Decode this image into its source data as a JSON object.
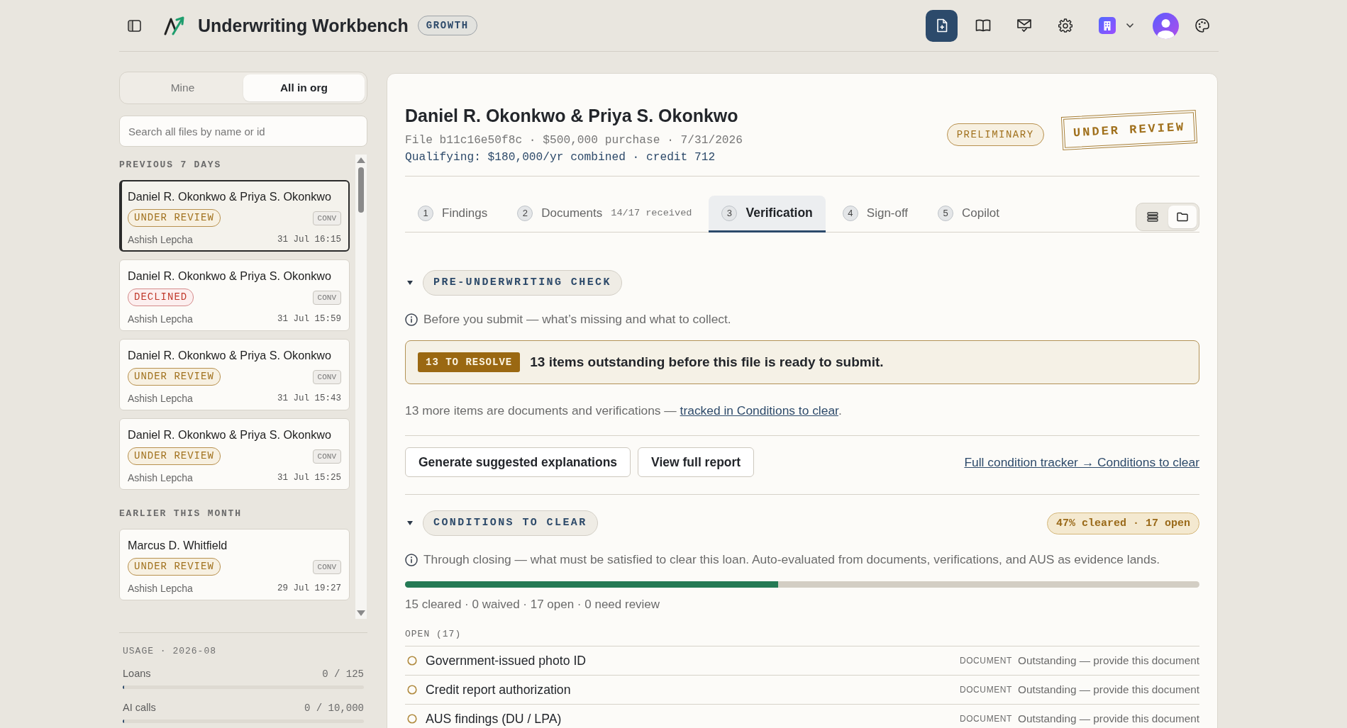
{
  "header": {
    "title": "Underwriting Workbench",
    "plan": "GROWTH"
  },
  "sidebar": {
    "scope_tabs": [
      {
        "label": "Mine",
        "selected": false
      },
      {
        "label": "All in org",
        "selected": true
      }
    ],
    "search": {
      "placeholder": "Search all files by name or id"
    },
    "groups": [
      {
        "heading": "PREVIOUS 7 DAYS",
        "files": [
          {
            "name": "Daniel R. Okonkwo & Priya S. Okonkwo",
            "status": {
              "label": "UNDER REVIEW",
              "kind": "review"
            },
            "program": "CONV",
            "owner": "Ashish Lepcha",
            "time": "31 Jul 16:15",
            "selected": true
          },
          {
            "name": "Daniel R. Okonkwo & Priya S. Okonkwo",
            "status": {
              "label": "DECLINED",
              "kind": "declined"
            },
            "program": "CONV",
            "owner": "Ashish Lepcha",
            "time": "31 Jul 15:59",
            "selected": false
          },
          {
            "name": "Daniel R. Okonkwo & Priya S. Okonkwo",
            "status": {
              "label": "UNDER REVIEW",
              "kind": "review"
            },
            "program": "CONV",
            "owner": "Ashish Lepcha",
            "time": "31 Jul 15:43",
            "selected": false
          },
          {
            "name": "Daniel R. Okonkwo & Priya S. Okonkwo",
            "status": {
              "label": "UNDER REVIEW",
              "kind": "review"
            },
            "program": "CONV",
            "owner": "Ashish Lepcha",
            "time": "31 Jul 15:25",
            "selected": false
          }
        ]
      },
      {
        "heading": "EARLIER THIS MONTH",
        "files": [
          {
            "name": "Marcus D. Whitfield",
            "status": {
              "label": "UNDER REVIEW",
              "kind": "review"
            },
            "program": "CONV",
            "owner": "Ashish Lepcha",
            "time": "29 Jul 19:27",
            "selected": false
          }
        ]
      }
    ],
    "usage": {
      "heading": "USAGE · 2026-08",
      "meters": [
        {
          "label": "Loans",
          "reading": "0 / 125",
          "level": 0
        },
        {
          "label": "AI calls",
          "reading": "0 / 10,000",
          "level": 0
        }
      ]
    }
  },
  "file": {
    "title": "Daniel R. Okonkwo & Priya S. Okonkwo",
    "meta": "File b11c16e50f8c · $500,000 purchase · 7/31/2026",
    "qualifying": "Qualifying: $180,000/yr combined · credit 712",
    "stage": "PRELIMINARY",
    "stamp": "UNDER REVIEW"
  },
  "tabs": [
    {
      "number": "1",
      "label": "Findings",
      "selected": false
    },
    {
      "number": "2",
      "label": "Documents",
      "note": "14/17 received",
      "selected": false
    },
    {
      "number": "3",
      "label": "Verification",
      "selected": true
    },
    {
      "number": "4",
      "label": "Sign-off",
      "selected": false
    },
    {
      "number": "5",
      "label": "Copilot",
      "selected": false
    }
  ],
  "view_toggle": [
    {
      "kind": "list",
      "selected": false
    },
    {
      "kind": "folder",
      "selected": true
    }
  ],
  "pre_underwriting": {
    "title": "PRE-UNDERWRITING CHECK",
    "expanded": true,
    "info": "Before you submit — what’s missing and what to collect.",
    "callout": {
      "badge": "13 TO RESOLVE",
      "text": "13 items outstanding before this file is ready to submit."
    },
    "note": {
      "text": "13 more items are documents and verifications — ",
      "link": "tracked in Conditions to clear",
      "after": "."
    },
    "actions": [
      "Generate suggested explanations",
      "View full report"
    ],
    "tracker_link": "Full condition tracker → Conditions to clear"
  },
  "conditions": {
    "title": "CONDITIONS TO CLEAR",
    "expanded": true,
    "summary": "47% cleared · 17 open",
    "info": "Through closing — what must be satisfied to clear this loan. Auto-evaluated from documents, verifications, and AUS as evidence lands.",
    "level": 0.47,
    "stats": "15 cleared · 0 waived · 17 open · 0 need review",
    "list_heading": "OPEN (17)",
    "items": [
      {
        "name": "Government-issued photo ID",
        "type": "DOCUMENT",
        "status": "Outstanding — provide this document",
        "cleared": false
      },
      {
        "name": "Credit report authorization",
        "type": "DOCUMENT",
        "status": "Outstanding — provide this document",
        "cleared": false
      },
      {
        "name": "AUS findings (DU / LPA)",
        "type": "DOCUMENT",
        "status": "Outstanding — provide this document",
        "cleared": false
      }
    ]
  }
}
